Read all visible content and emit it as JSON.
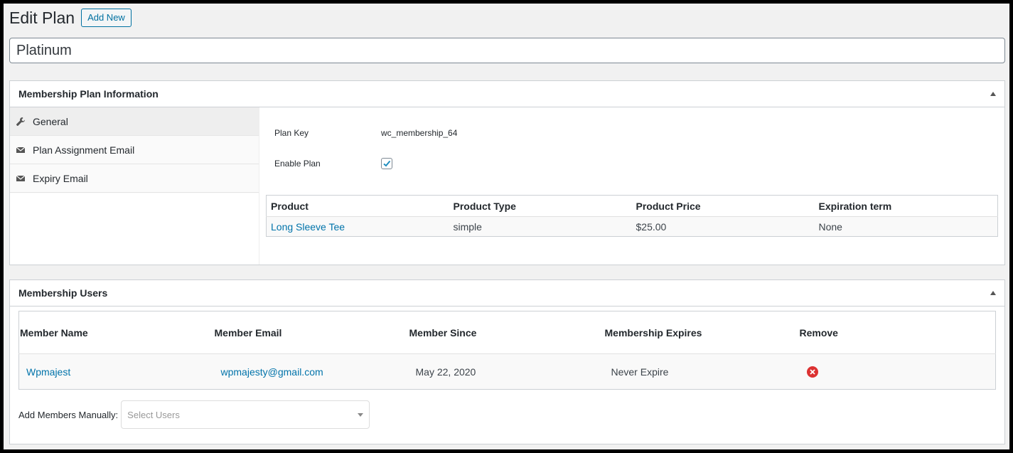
{
  "header": {
    "title": "Edit Plan",
    "add_new_label": "Add New"
  },
  "plan_title": "Platinum",
  "plan_info": {
    "title": "Membership Plan Information",
    "tabs": [
      {
        "label": "General",
        "icon": "wrench-icon",
        "active": true
      },
      {
        "label": "Plan Assignment Email",
        "icon": "envelope-icon",
        "active": false
      },
      {
        "label": "Expiry Email",
        "icon": "envelope-icon",
        "active": false
      }
    ],
    "plan_key_label": "Plan Key",
    "plan_key_value": "wc_membership_64",
    "enable_plan_label": "Enable Plan",
    "enable_plan_checked": true,
    "products": {
      "columns": [
        "Product",
        "Product Type",
        "Product Price",
        "Expiration term"
      ],
      "rows": [
        {
          "product": "Long Sleeve Tee",
          "type": "simple",
          "price": "$25.00",
          "expiration": "None"
        }
      ]
    }
  },
  "users": {
    "title": "Membership Users",
    "columns": [
      "Member Name",
      "Member Email",
      "Member Since",
      "Membership Expires",
      "Remove"
    ],
    "rows": [
      {
        "name": "Wpmajest",
        "email": "wpmajesty@gmail.com",
        "since": "May 22, 2020",
        "expires": "Never Expire"
      }
    ],
    "add_label": "Add Members Manually:",
    "select_placeholder": "Select Users"
  },
  "colors": {
    "link": "#0073aa",
    "remove": "#dc3232",
    "button_border": "#0071a1"
  }
}
